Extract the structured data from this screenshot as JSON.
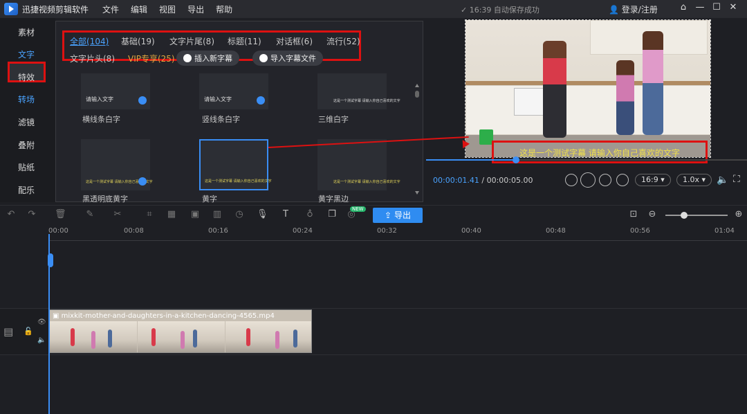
{
  "app": {
    "name": "迅捷视频剪辑软件",
    "menu": [
      "文件",
      "编辑",
      "视图",
      "导出",
      "帮助"
    ],
    "save_status": "16:39 自动保存成功",
    "login": "登录/注册",
    "window_controls": [
      "home-icon",
      "minimize-icon",
      "maximize-icon",
      "close-icon"
    ]
  },
  "sidebar": {
    "items": [
      {
        "label": "素材"
      },
      {
        "label": "文字"
      },
      {
        "label": "特效"
      },
      {
        "label": "转场"
      },
      {
        "label": "滤镜"
      },
      {
        "label": "叠附"
      },
      {
        "label": "贴纸"
      },
      {
        "label": "配乐"
      }
    ],
    "active_index": 1
  },
  "library": {
    "tabs": [
      "全部(104)",
      "基础(19)",
      "文字片尾(8)",
      "标题(11)",
      "对话框(6)",
      "流行(52)",
      "文字片头(8)",
      "VIP专享(25)"
    ],
    "active_tab": 0,
    "actions": [
      "插入新字幕",
      "导入字幕文件"
    ],
    "cards": [
      {
        "thumb_text": "请输入文字",
        "label": "横线条白字",
        "download": true
      },
      {
        "thumb_text": "请输入文字",
        "label": "竖线条白字",
        "download": true
      },
      {
        "thumb_text": "这是一个测试字幕 请输入你自己喜欢的文字",
        "label": "三维白字",
        "download": false
      },
      {
        "thumb_text": "这是一个测试字幕 请输入你自己喜欢的文字",
        "label": "黑透明底黄字",
        "download": true
      },
      {
        "thumb_text": "这是一个测试字幕 请输入你自己喜欢的文字",
        "label": "黄字",
        "download": false
      },
      {
        "thumb_text": "这是一个测试字幕 请输入你自己喜欢的文字",
        "label": "黄字黑边",
        "download": false
      }
    ],
    "selected_card": 4
  },
  "preview": {
    "subtitle": "这是一个测试字幕 请输入你自己喜欢的文字",
    "current_time": "00:00:01.41",
    "total_time": "/ 00:00:05.00",
    "progress": 0.28,
    "aspect": "16:9",
    "speed": "1.0x"
  },
  "timeline": {
    "export_label": "导出",
    "new_badge": "NEW",
    "ruler": [
      "00:00",
      "00:08",
      "00:16",
      "00:24",
      "00:32",
      "00:40",
      "00:48",
      "00:56",
      "01:04"
    ],
    "clip_name": "mixkit-mother-and-daughters-in-a-kitchen-dancing-4565.mp4",
    "zoom": 0.3
  },
  "colors": {
    "accent": "#3a8ef5",
    "highlight_box": "#dd1111",
    "subtitle_text": "#f0e14a"
  }
}
